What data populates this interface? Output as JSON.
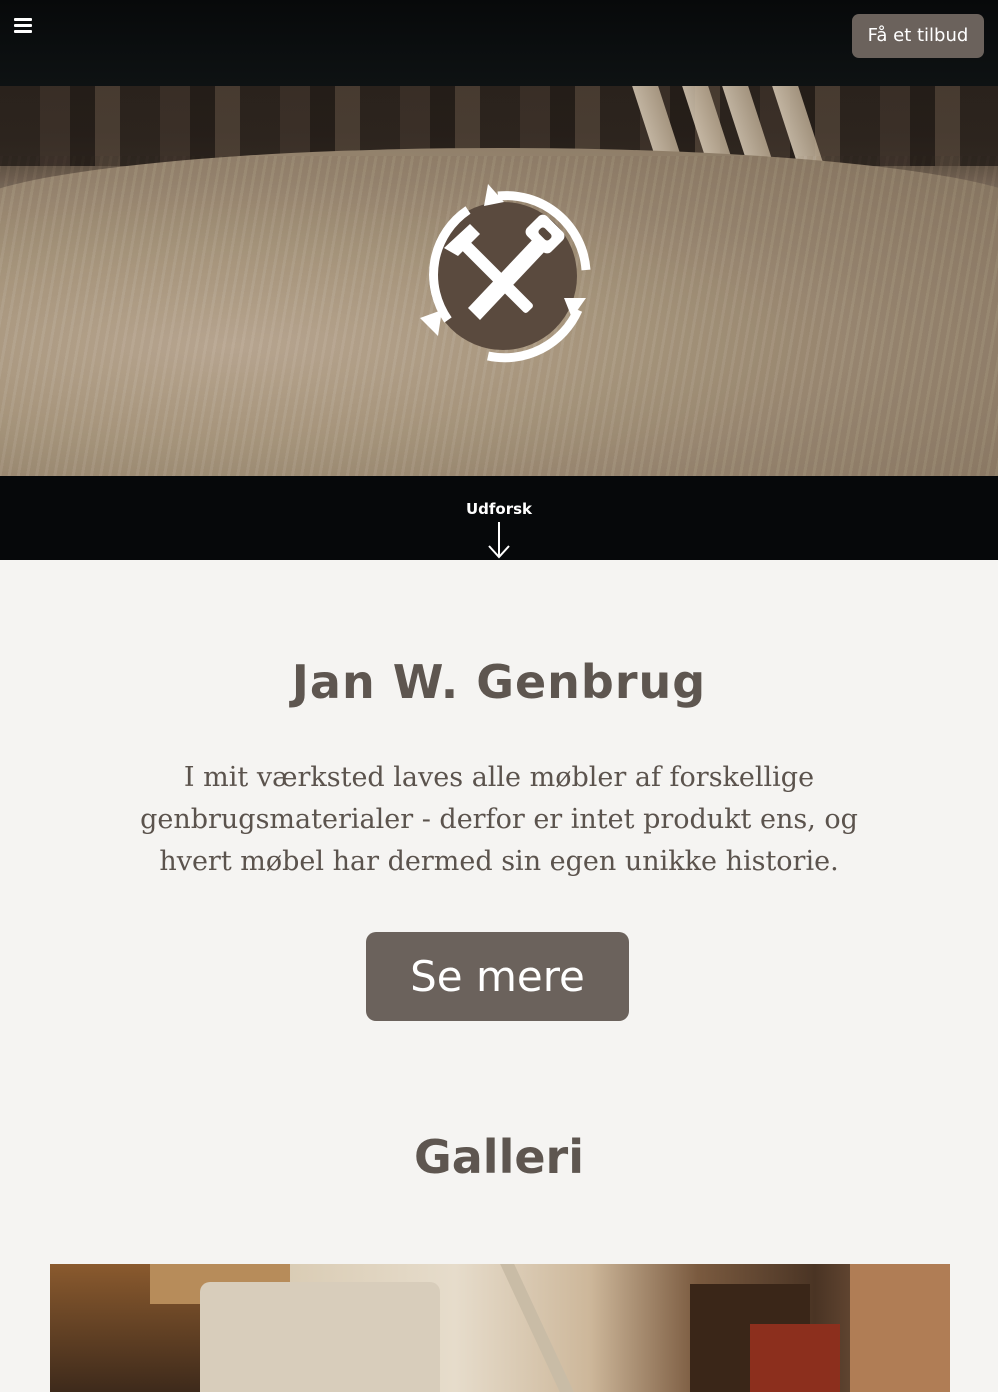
{
  "header": {
    "menu_icon": "hamburger-menu-icon",
    "quote_button": "Få et tilbud"
  },
  "hero": {
    "logo_icon": "hammer-saw-recycle-icon",
    "explore_label": "Udforsk",
    "explore_icon": "arrow-down-icon"
  },
  "main": {
    "title": "Jan W. Genbrug",
    "intro": "I mit værksted laves alle møbler af forskellige genbrugsmaterialer - derfor er intet produkt ens, og hvert møbel har dermed sin egen unikke historie.",
    "more_button": "Se mere"
  },
  "gallery": {
    "title": "Galleri"
  },
  "colors": {
    "button_bg": "#6b625c",
    "page_bg": "#f5f4f2",
    "heading_text": "#5e5650"
  }
}
